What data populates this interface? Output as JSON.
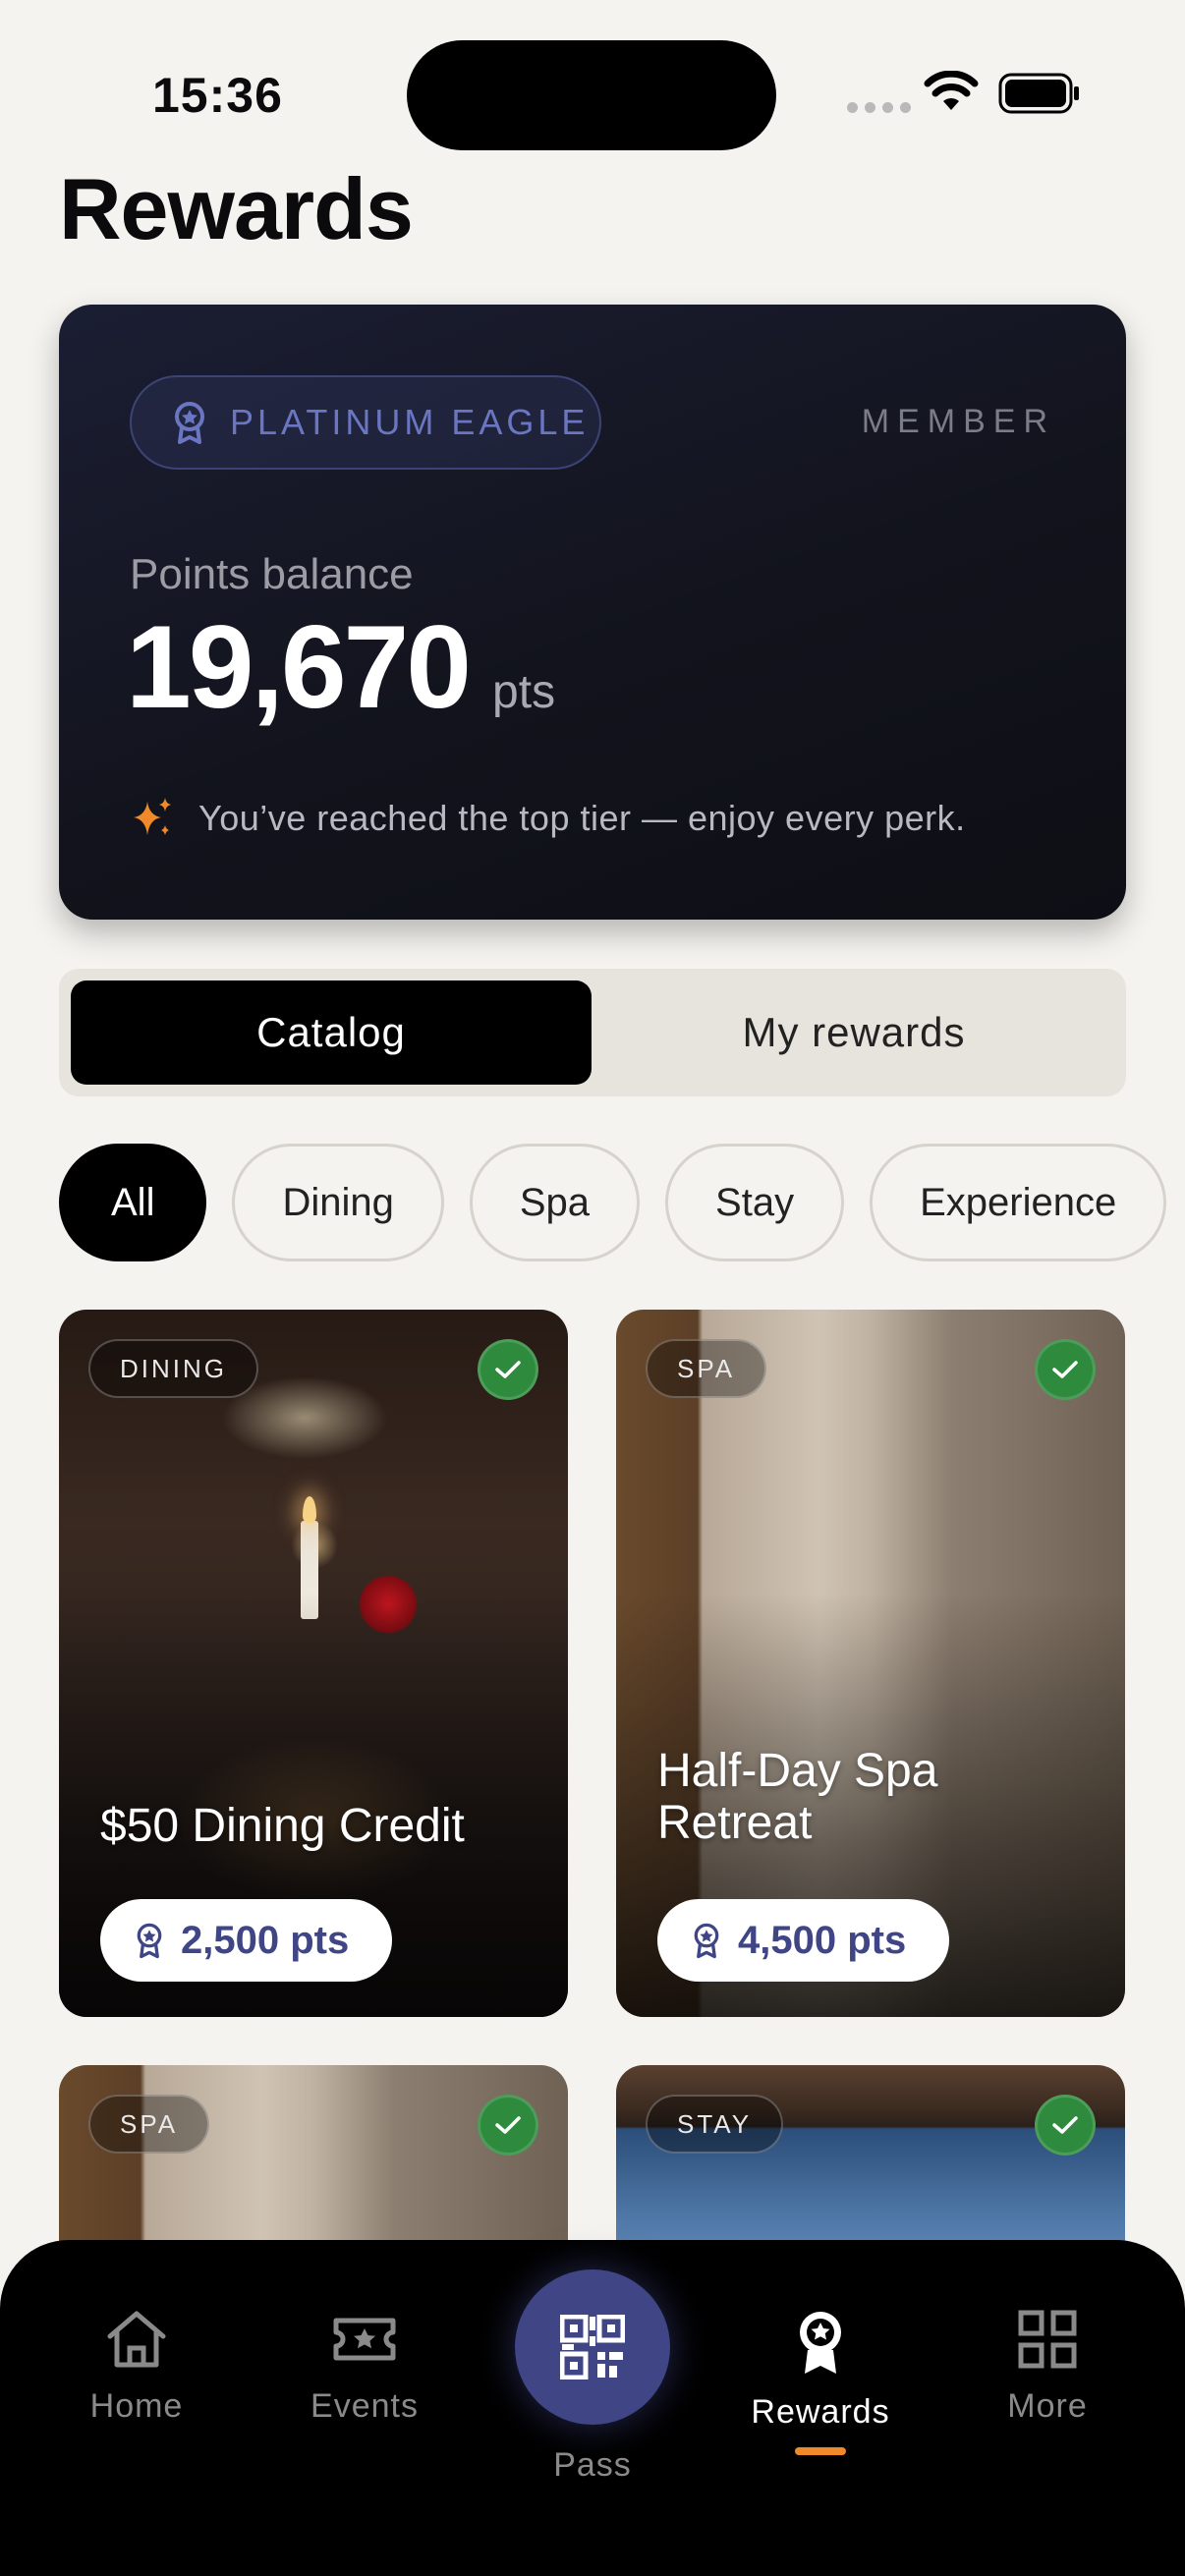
{
  "status_bar": {
    "time": "15:36"
  },
  "page": {
    "title": "Rewards"
  },
  "tier_card": {
    "tier": "PLATINUM EAGLE",
    "member_label": "MEMBER",
    "points_caption": "Points balance",
    "points_value": "19,670",
    "points_unit": "pts",
    "message": "You’ve reached the top tier — enjoy every perk."
  },
  "tabs": {
    "catalog": "Catalog",
    "my_rewards": "My rewards",
    "selected": "Catalog"
  },
  "filters": [
    "All",
    "Dining",
    "Spa",
    "Stay",
    "Experience"
  ],
  "selected_filter": "All",
  "rewards": [
    {
      "category": "DINING",
      "title": "$50 Dining Credit",
      "price": "2,500 pts",
      "unlocked": true
    },
    {
      "category": "SPA",
      "title": "Half-Day Spa Retreat",
      "price": "4,500 pts",
      "unlocked": true
    },
    {
      "category": "SPA",
      "title": "",
      "price": "",
      "unlocked": true
    },
    {
      "category": "STAY",
      "title": "",
      "price": "",
      "unlocked": true
    }
  ],
  "nav": {
    "home": "Home",
    "events": "Events",
    "pass": "Pass",
    "rewards": "Rewards",
    "more": "More",
    "active": "Rewards"
  },
  "colors": {
    "accent": "#3f4585",
    "indicator": "#f0892a",
    "check": "#2e8b3e",
    "card_bg": "#12131c"
  }
}
